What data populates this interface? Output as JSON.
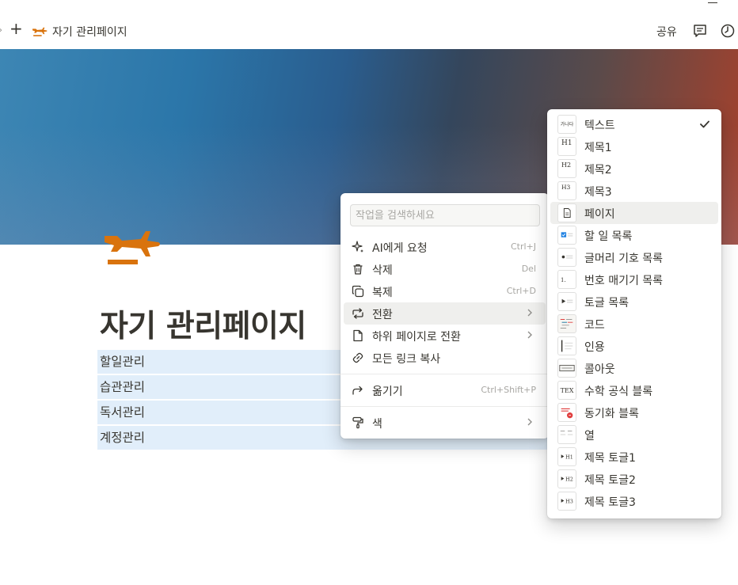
{
  "topbar": {
    "breadcrumb": "자기 관리페이지",
    "share_label": "공유",
    "icons": [
      "back-arrow-icon",
      "plus-icon",
      "airplane-icon",
      "comment-icon",
      "history-icon"
    ]
  },
  "page": {
    "title": "자기 관리페이지",
    "icon": "airplane-icon",
    "items": [
      "할일관리",
      "습관관리",
      "독서관리",
      "계정관리"
    ]
  },
  "context_menu": {
    "search_placeholder": "작업을 검색하세요",
    "items": [
      {
        "label": "AI에게 요청",
        "shortcut": "Ctrl+J",
        "icon": "sparkle-icon"
      },
      {
        "label": "삭제",
        "shortcut": "Del",
        "icon": "trash-icon"
      },
      {
        "label": "복제",
        "shortcut": "Ctrl+D",
        "icon": "duplicate-icon"
      },
      {
        "label": "전환",
        "shortcut": "",
        "icon": "turn-into-icon",
        "has_submenu": true,
        "highlighted": true
      },
      {
        "label": "하위 페이지로 전환",
        "shortcut": "",
        "icon": "page-icon",
        "has_submenu": true
      },
      {
        "label": "모든 링크 복사",
        "shortcut": "",
        "icon": "link-icon"
      },
      {
        "label": "옮기기",
        "shortcut": "Ctrl+Shift+P",
        "icon": "move-icon"
      },
      {
        "label": "색",
        "shortcut": "",
        "icon": "paint-roller-icon",
        "has_submenu": true
      }
    ]
  },
  "turn_into_menu": {
    "items": [
      {
        "label": "텍스트",
        "thumb": "가나다",
        "checked": true
      },
      {
        "label": "제목1",
        "thumb": "H1"
      },
      {
        "label": "제목2",
        "thumb": "H2"
      },
      {
        "label": "제목3",
        "thumb": "H3"
      },
      {
        "label": "페이지",
        "thumb": "page",
        "highlighted": true
      },
      {
        "label": "할 일 목록",
        "thumb": "todo"
      },
      {
        "label": "글머리 기호 목록",
        "thumb": "bullet"
      },
      {
        "label": "번호 매기기 목록",
        "thumb": "numbered"
      },
      {
        "label": "토글 목록",
        "thumb": "toggle"
      },
      {
        "label": "코드",
        "thumb": "code"
      },
      {
        "label": "인용",
        "thumb": "quote"
      },
      {
        "label": "콜아웃",
        "thumb": "callout"
      },
      {
        "label": "수학 공식 블록",
        "thumb": "TEX"
      },
      {
        "label": "동기화 블록",
        "thumb": "sync"
      },
      {
        "label": "열",
        "thumb": "columns"
      },
      {
        "label": "제목 토글1",
        "thumb": "H1 toggle"
      },
      {
        "label": "제목 토글2",
        "thumb": "H2 toggle"
      },
      {
        "label": "제목 토글3",
        "thumb": "H3 toggle"
      }
    ]
  },
  "colors": {
    "accent_orange": "#d9730d",
    "item_highlight": "#e1eefa",
    "menu_hover": "#efefed",
    "check_blue": "#2383e2"
  }
}
